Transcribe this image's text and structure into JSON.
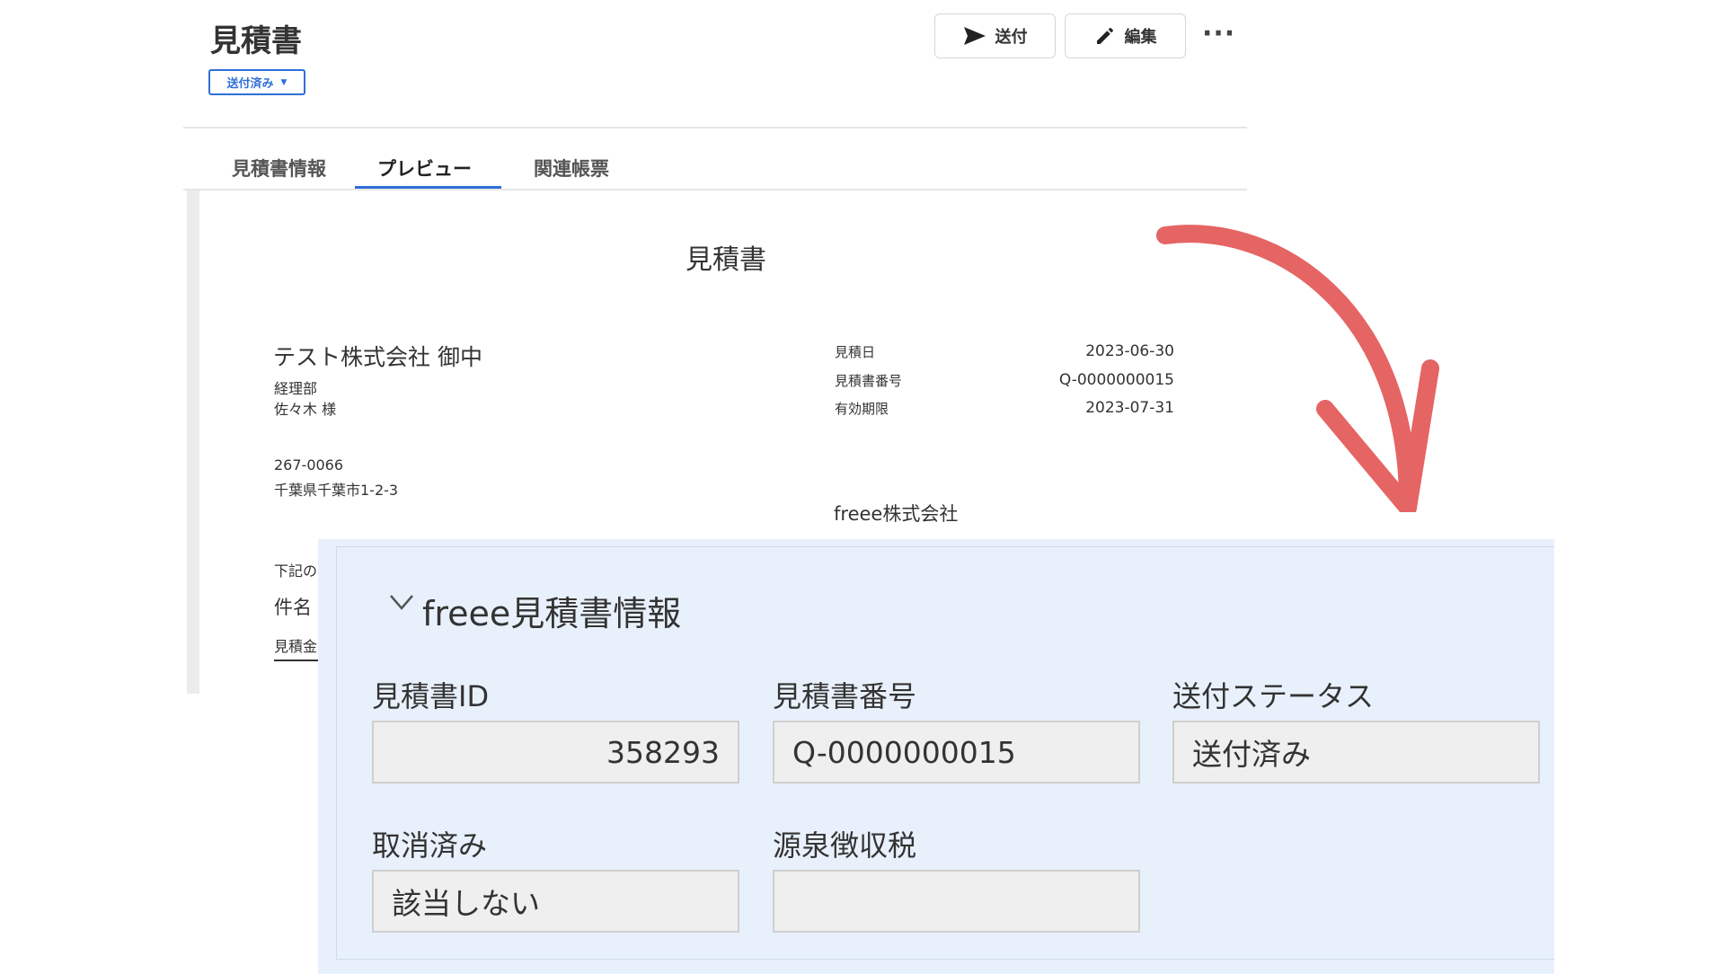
{
  "header": {
    "title": "見積書",
    "status_label": "送付済み",
    "send_label": "送付",
    "edit_label": "編集",
    "more_label": "···"
  },
  "tabs": [
    {
      "label": "見積書情報"
    },
    {
      "label": "プレビュー"
    },
    {
      "label": "関連帳票"
    }
  ],
  "document": {
    "title": "見積書",
    "client_name": "テスト株式会社 御中",
    "department": "経理部",
    "person": "佐々木 様",
    "postal_code": "267-0066",
    "address": "千葉県千葉市1-2-3",
    "meta": [
      {
        "label": "見積日",
        "value": "2023-06-30"
      },
      {
        "label": "見積書番号",
        "value": "Q-0000000015"
      },
      {
        "label": "有効期限",
        "value": "2023-07-31"
      }
    ],
    "issuer": "freee株式会社",
    "fragments": [
      "下記の",
      "件名",
      "見積金"
    ]
  },
  "panel": {
    "title": "freee見積書情報",
    "fields": [
      {
        "label": "見積書ID",
        "value": "358293"
      },
      {
        "label": "見積書番号",
        "value": "Q-0000000015"
      },
      {
        "label": "送付ステータス",
        "value": "送付済み"
      },
      {
        "label": "取消済み",
        "value": "該当しない"
      },
      {
        "label": "源泉徴収税",
        "value": ""
      }
    ]
  },
  "colors": {
    "accent": "#2f6fd6",
    "arrow": "#e56464",
    "panel_bg": "#e8f1fb"
  }
}
